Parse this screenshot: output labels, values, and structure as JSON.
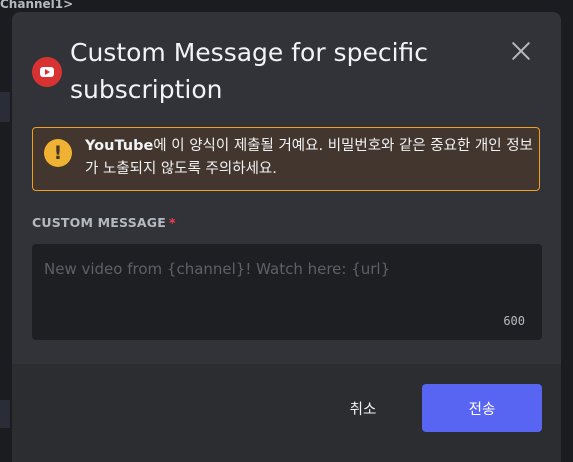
{
  "background": {
    "top_text": "Channel1>"
  },
  "modal": {
    "title": "Custom Message for specific subscription",
    "icon": "youtube-icon",
    "close_icon": "close-icon"
  },
  "warning": {
    "icon": "warning-icon",
    "icon_glyph": "!",
    "strong_text": "YouTube",
    "text": "에 이 양식이 제출될 거예요. 비밀번호와 같은 중요한 개인 정보가 노출되지 않도록 주의하세요."
  },
  "form": {
    "label": "CUSTOM MESSAGE",
    "required_marker": "*",
    "placeholder": "New video from {channel}! Watch here: {url}",
    "value": "",
    "char_limit": "600"
  },
  "footer": {
    "cancel_label": "취소",
    "submit_label": "전송"
  },
  "colors": {
    "accent": "#5865f2",
    "warning_border": "#f0a020",
    "youtube_red": "#d93232",
    "required": "#f23f43"
  }
}
